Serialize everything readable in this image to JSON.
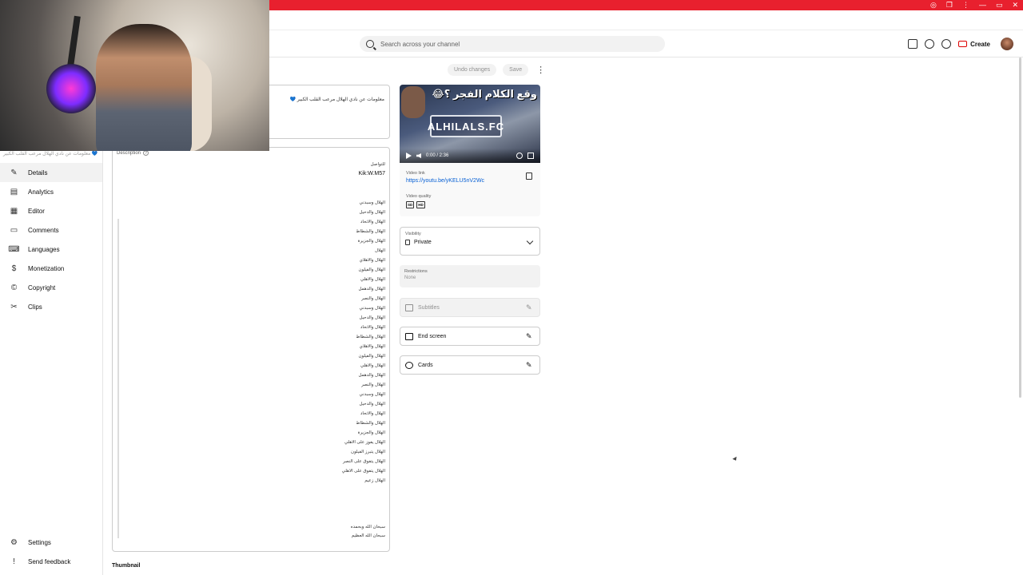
{
  "browser": {
    "controls": [
      "◎",
      "❐",
      "⋮",
      "—",
      "▭",
      "✕"
    ]
  },
  "header": {
    "search_placeholder": "Search across your channel",
    "create_label": "Create"
  },
  "sidebar": {
    "ghost_title": "معلومات عن نادي الهلال مرعب القلب الكبير 💙",
    "items": [
      {
        "label": "Details",
        "icon": "pencil-icon"
      },
      {
        "label": "Analytics",
        "icon": "analytics-icon"
      },
      {
        "label": "Editor",
        "icon": "editor-icon"
      },
      {
        "label": "Comments",
        "icon": "comments-icon"
      },
      {
        "label": "Languages",
        "icon": "languages-icon"
      },
      {
        "label": "Monetization",
        "icon": "dollar-icon"
      },
      {
        "label": "Copyright",
        "icon": "copyright-icon"
      },
      {
        "label": "Clips",
        "icon": "scissors-icon"
      }
    ],
    "bottom": [
      {
        "label": "Settings",
        "icon": "gear-icon"
      },
      {
        "label": "Send feedback",
        "icon": "feedback-icon"
      }
    ]
  },
  "toolbar": {
    "undo_label": "Undo changes",
    "save_label": "Save"
  },
  "details": {
    "title_text": "معلومات عن نادي الهلال مرعب القلب الكبير 💙",
    "description_label": "Description",
    "description_head": [
      "للتواصل",
      "Kik:W.M57"
    ],
    "description_lines": [
      "الهلال وسبدني",
      "الهلال والدحيل",
      "الهلال والاتحاد",
      "الهلال والشطاط",
      "الهلال والجزيرة",
      "الهلال",
      "الهلال والاهلاي",
      "الهلال والفيلون",
      "الهلال والاهلي",
      "الهلال والدهمل",
      "الهلال والنصر",
      "الهلال وسبدني",
      "الهلال والدحيل",
      "الهلال والاتحاد",
      "الهلال والشطاط",
      "الهلال والاهلاي",
      "الهلال والفيلون",
      "الهلال والاهلي",
      "الهلال والدهمل",
      "الهلال والنصر",
      "الهلال وسبدني",
      "الهلال والدحيل",
      "الهلال والاتحاد",
      "الهلال والشطاط",
      "الهلال والجزيرة",
      "الهلال يفوز على الاهلي",
      "الهلال يتبرز الفيلون",
      "الهلال يتفوق على النصر",
      "الهلال يتفوق على الاهلي",
      "الهلال زعيم"
    ],
    "description_footer": [
      "سبحان الله وبحمده",
      "سبحان الله العظيم"
    ],
    "thumbnail_label": "Thumbnail"
  },
  "video": {
    "overlay_title": "وقع الكلام الفجر ؟😂",
    "logo_text": "ALHILALS.FC",
    "time": "0:00 / 2:36",
    "link_label": "Video link",
    "link": "https://youtu.be/yKELU5nV2Wc",
    "quality_label": "Video quality",
    "quality_badges": [
      "SD",
      "HD"
    ]
  },
  "visibility": {
    "label": "Visibility",
    "value": "Private"
  },
  "restrictions": {
    "label": "Restrictions",
    "value": "None"
  },
  "rows": {
    "subtitles": "Subtitles",
    "end_screen": "End screen",
    "cards": "Cards"
  }
}
